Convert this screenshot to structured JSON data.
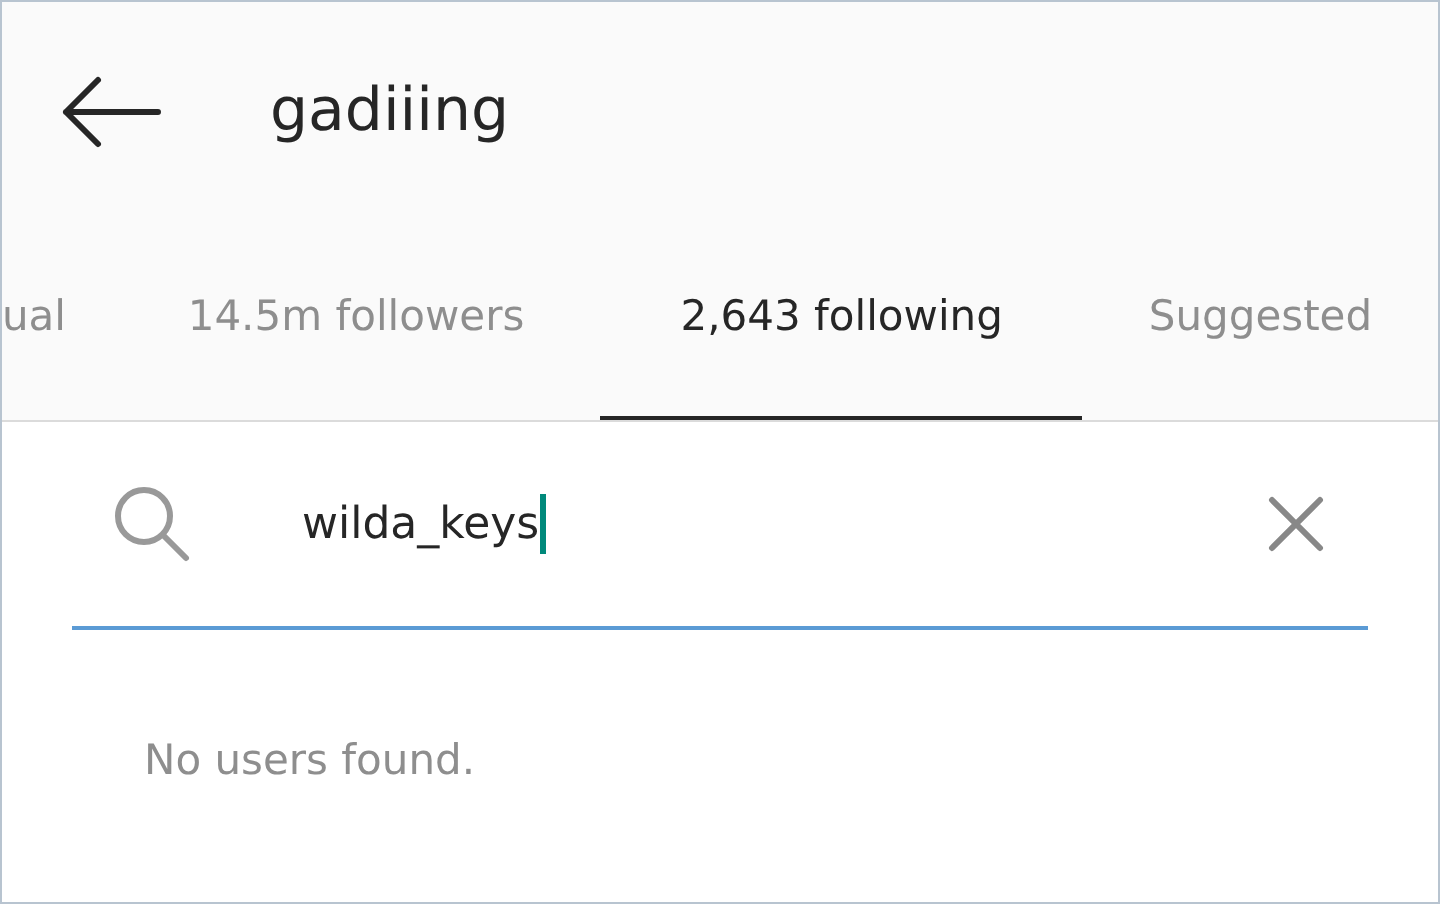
{
  "header": {
    "title": "gadiiing"
  },
  "tabs": [
    {
      "label": "ual",
      "selected": false
    },
    {
      "label": "14.5m followers",
      "selected": false
    },
    {
      "label": "2,643 following",
      "selected": true
    },
    {
      "label": "Suggested",
      "selected": false
    }
  ],
  "search": {
    "value": "wilda_keys"
  },
  "message": "No users found."
}
